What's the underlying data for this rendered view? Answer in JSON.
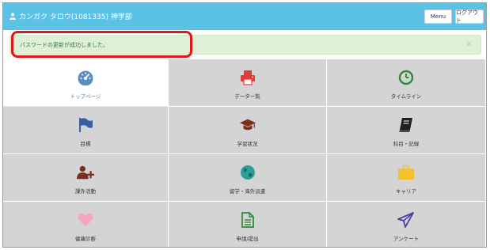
{
  "header": {
    "user_name": "カンガク タロウ(1081335) 神学部",
    "menu_label": "Menu",
    "logout_label": "ログアウト",
    "bar_color": "#5bc2e6"
  },
  "alert": {
    "message": "パスワードの更新が成功しました。",
    "close_symbol": "×",
    "highlight_color": "#e0161d"
  },
  "menu_items": [
    {
      "label": "トップページ",
      "icon": "dashboard-icon",
      "active": true
    },
    {
      "label": "データ一覧",
      "icon": "printer-icon",
      "active": false
    },
    {
      "label": "タイムライン",
      "icon": "clock-icon",
      "active": false
    },
    {
      "label": "目標",
      "icon": "flag-icon",
      "active": false
    },
    {
      "label": "学習状況",
      "icon": "graduation-cap-icon",
      "active": false
    },
    {
      "label": "科目・記録",
      "icon": "book-icon",
      "active": false
    },
    {
      "label": "課外活動",
      "icon": "user-plus-icon",
      "active": false
    },
    {
      "label": "留学・海外派遣",
      "icon": "globe-icon",
      "active": false
    },
    {
      "label": "キャリア",
      "icon": "briefcase-icon",
      "active": false
    },
    {
      "label": "健康診断",
      "icon": "heart-icon",
      "active": false
    },
    {
      "label": "申請/提出",
      "icon": "document-icon",
      "active": false
    },
    {
      "label": "アンケート",
      "icon": "paper-plane-icon",
      "active": false
    }
  ]
}
